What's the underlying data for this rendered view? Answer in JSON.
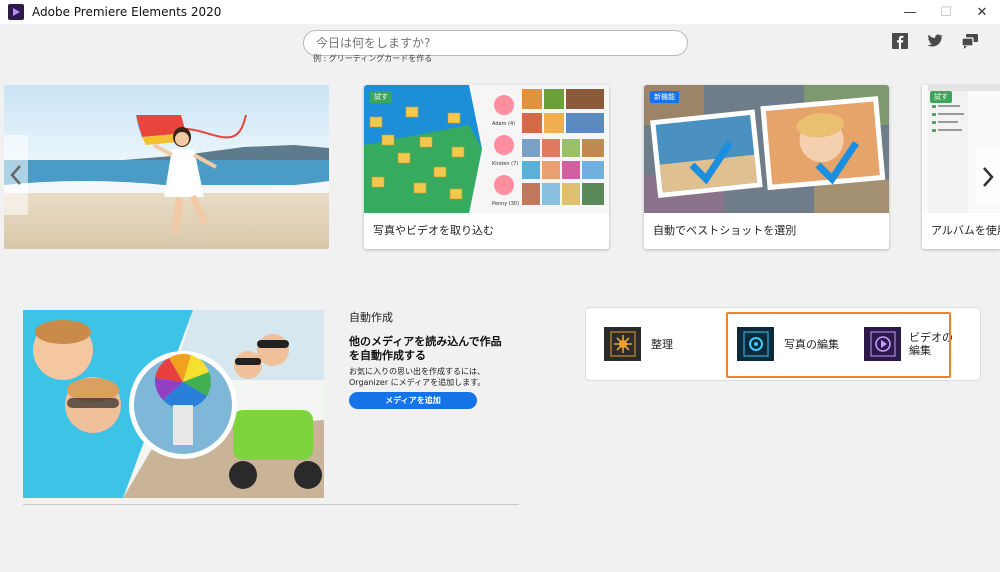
{
  "window": {
    "title": "Adobe Premiere Elements 2020",
    "minimize": "—",
    "maximize": "☐",
    "close": "✕"
  },
  "search": {
    "placeholder": "今日は何をしますか?",
    "hint": "例 : グリーティングカードを作る"
  },
  "social": [
    "facebook-icon",
    "twitter-icon",
    "feedback-icon"
  ],
  "carousel": {
    "cards": [
      {
        "label": "写真やビデオを取り込む",
        "badge": "試す"
      },
      {
        "label": "自動でベストショットを選別",
        "badge": "新機能"
      },
      {
        "label": "アルバムを使用",
        "badge": "試す"
      }
    ],
    "import_names": [
      "Adam (4)",
      "Kirsten (7)",
      "Penny (30)"
    ]
  },
  "auto_create": {
    "title": "自動作成",
    "heading": "他のメディアを読み込んで作品を自動作成する",
    "description": "お気に入りの思い出を作成するには、Organizer にメディアを追加します。",
    "button": "メディアを追加"
  },
  "launcher": {
    "organizer": "整理",
    "photo_editor": "写真の編集",
    "video_editor": "ビデオの編集"
  },
  "colors": {
    "accent_blue": "#1473e6",
    "highlight_orange": "#f0822a",
    "organizer_icon": "#2b2b2b",
    "photo_icon": "#0d2a3a",
    "video_icon": "#2b1a4a"
  }
}
